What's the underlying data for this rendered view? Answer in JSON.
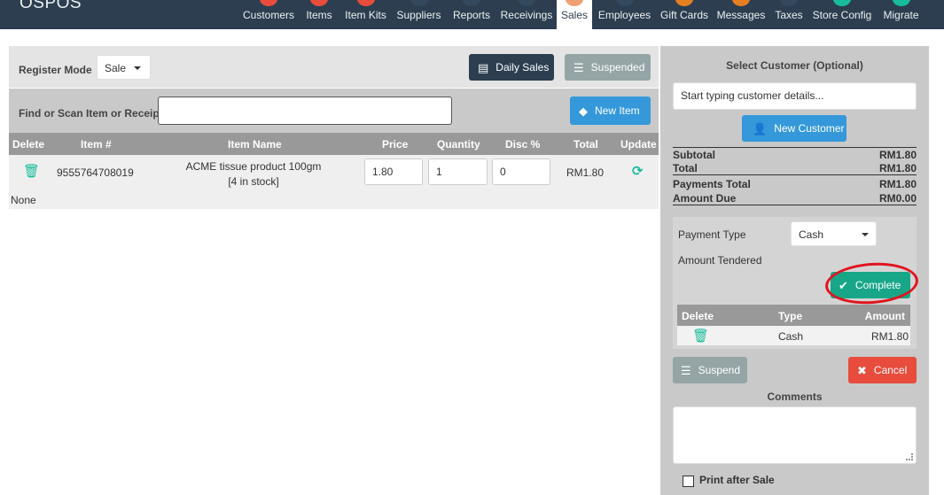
{
  "app": {
    "brand": "OSPOS"
  },
  "nav": [
    {
      "label": "Customers",
      "color": "#e74c3c"
    },
    {
      "label": "Items",
      "color": "#e74c3c"
    },
    {
      "label": "Item Kits",
      "color": "#e74c3c"
    },
    {
      "label": "Suppliers",
      "color": "#34495e"
    },
    {
      "label": "Reports",
      "color": "#34495e"
    },
    {
      "label": "Receivings",
      "color": "#34495e"
    },
    {
      "label": "Sales",
      "color": "#f0a070",
      "active": true
    },
    {
      "label": "Employees",
      "color": "#34495e"
    },
    {
      "label": "Gift Cards",
      "color": "#e67e22"
    },
    {
      "label": "Messages",
      "color": "#e67e22"
    },
    {
      "label": "Taxes",
      "color": "#34495e"
    },
    {
      "label": "Store Config",
      "color": "#18bc9c"
    },
    {
      "label": "Migrate",
      "color": "#18bc9c"
    }
  ],
  "register": {
    "mode_label": "Register Mode",
    "mode_value": "Sale",
    "daily_sales_button": "Daily Sales",
    "suspended_button": "Suspended"
  },
  "find": {
    "label": "Find or Scan Item or Receipt",
    "value": "",
    "new_item_button": "New Item"
  },
  "cart": {
    "headers": [
      "Delete",
      "Item #",
      "Item Name",
      "Price",
      "Quantity",
      "Disc %",
      "Total",
      "Update"
    ],
    "rows": [
      {
        "item_number": "9555764708019",
        "item_name": "ACME tissue product 100gm",
        "stock": "[4 in stock]",
        "price": "1.80",
        "quantity": "1",
        "discount": "0",
        "total": "RM1.80",
        "description": "None"
      }
    ]
  },
  "customer": {
    "title": "Select Customer (Optional)",
    "placeholder": "Start typing customer details...",
    "new_customer_button": "New Customer"
  },
  "totals": {
    "subtotal_label": "Subtotal",
    "subtotal": "RM1.80",
    "total_label": "Total",
    "total": "RM1.80",
    "payments_total_label": "Payments Total",
    "payments_total": "RM1.80",
    "amount_due_label": "Amount Due",
    "amount_due": "RM0.00"
  },
  "payment": {
    "type_label": "Payment Type",
    "type_value": "Cash",
    "amount_tendered_label": "Amount Tendered",
    "complete_button": "Complete",
    "headers": [
      "Delete",
      "Type",
      "Amount"
    ],
    "rows": [
      {
        "type": "Cash",
        "amount": "RM1.80"
      }
    ]
  },
  "actions": {
    "suspend_button": "Suspend",
    "cancel_button": "Cancel"
  },
  "comments": {
    "label": "Comments",
    "value": ""
  },
  "print_after_sale": {
    "label": "Print after Sale",
    "checked": false
  },
  "colors": {
    "navbar": "#2c3e50",
    "success": "#18a689",
    "danger": "#e74c3c",
    "info": "#3498db",
    "annotation": "#e0141e"
  }
}
